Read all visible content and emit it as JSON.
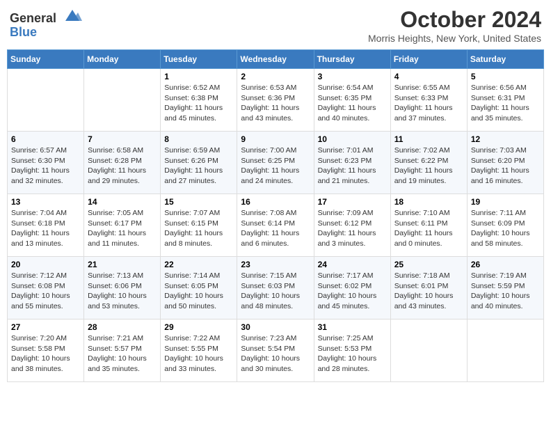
{
  "header": {
    "logo_general": "General",
    "logo_blue": "Blue",
    "month_title": "October 2024",
    "location": "Morris Heights, New York, United States"
  },
  "weekdays": [
    "Sunday",
    "Monday",
    "Tuesday",
    "Wednesday",
    "Thursday",
    "Friday",
    "Saturday"
  ],
  "weeks": [
    [
      {
        "day": "",
        "detail": ""
      },
      {
        "day": "",
        "detail": ""
      },
      {
        "day": "1",
        "detail": "Sunrise: 6:52 AM\nSunset: 6:38 PM\nDaylight: 11 hours\nand 45 minutes."
      },
      {
        "day": "2",
        "detail": "Sunrise: 6:53 AM\nSunset: 6:36 PM\nDaylight: 11 hours\nand 43 minutes."
      },
      {
        "day": "3",
        "detail": "Sunrise: 6:54 AM\nSunset: 6:35 PM\nDaylight: 11 hours\nand 40 minutes."
      },
      {
        "day": "4",
        "detail": "Sunrise: 6:55 AM\nSunset: 6:33 PM\nDaylight: 11 hours\nand 37 minutes."
      },
      {
        "day": "5",
        "detail": "Sunrise: 6:56 AM\nSunset: 6:31 PM\nDaylight: 11 hours\nand 35 minutes."
      }
    ],
    [
      {
        "day": "6",
        "detail": "Sunrise: 6:57 AM\nSunset: 6:30 PM\nDaylight: 11 hours\nand 32 minutes."
      },
      {
        "day": "7",
        "detail": "Sunrise: 6:58 AM\nSunset: 6:28 PM\nDaylight: 11 hours\nand 29 minutes."
      },
      {
        "day": "8",
        "detail": "Sunrise: 6:59 AM\nSunset: 6:26 PM\nDaylight: 11 hours\nand 27 minutes."
      },
      {
        "day": "9",
        "detail": "Sunrise: 7:00 AM\nSunset: 6:25 PM\nDaylight: 11 hours\nand 24 minutes."
      },
      {
        "day": "10",
        "detail": "Sunrise: 7:01 AM\nSunset: 6:23 PM\nDaylight: 11 hours\nand 21 minutes."
      },
      {
        "day": "11",
        "detail": "Sunrise: 7:02 AM\nSunset: 6:22 PM\nDaylight: 11 hours\nand 19 minutes."
      },
      {
        "day": "12",
        "detail": "Sunrise: 7:03 AM\nSunset: 6:20 PM\nDaylight: 11 hours\nand 16 minutes."
      }
    ],
    [
      {
        "day": "13",
        "detail": "Sunrise: 7:04 AM\nSunset: 6:18 PM\nDaylight: 11 hours\nand 13 minutes."
      },
      {
        "day": "14",
        "detail": "Sunrise: 7:05 AM\nSunset: 6:17 PM\nDaylight: 11 hours\nand 11 minutes."
      },
      {
        "day": "15",
        "detail": "Sunrise: 7:07 AM\nSunset: 6:15 PM\nDaylight: 11 hours\nand 8 minutes."
      },
      {
        "day": "16",
        "detail": "Sunrise: 7:08 AM\nSunset: 6:14 PM\nDaylight: 11 hours\nand 6 minutes."
      },
      {
        "day": "17",
        "detail": "Sunrise: 7:09 AM\nSunset: 6:12 PM\nDaylight: 11 hours\nand 3 minutes."
      },
      {
        "day": "18",
        "detail": "Sunrise: 7:10 AM\nSunset: 6:11 PM\nDaylight: 11 hours\nand 0 minutes."
      },
      {
        "day": "19",
        "detail": "Sunrise: 7:11 AM\nSunset: 6:09 PM\nDaylight: 10 hours\nand 58 minutes."
      }
    ],
    [
      {
        "day": "20",
        "detail": "Sunrise: 7:12 AM\nSunset: 6:08 PM\nDaylight: 10 hours\nand 55 minutes."
      },
      {
        "day": "21",
        "detail": "Sunrise: 7:13 AM\nSunset: 6:06 PM\nDaylight: 10 hours\nand 53 minutes."
      },
      {
        "day": "22",
        "detail": "Sunrise: 7:14 AM\nSunset: 6:05 PM\nDaylight: 10 hours\nand 50 minutes."
      },
      {
        "day": "23",
        "detail": "Sunrise: 7:15 AM\nSunset: 6:03 PM\nDaylight: 10 hours\nand 48 minutes."
      },
      {
        "day": "24",
        "detail": "Sunrise: 7:17 AM\nSunset: 6:02 PM\nDaylight: 10 hours\nand 45 minutes."
      },
      {
        "day": "25",
        "detail": "Sunrise: 7:18 AM\nSunset: 6:01 PM\nDaylight: 10 hours\nand 43 minutes."
      },
      {
        "day": "26",
        "detail": "Sunrise: 7:19 AM\nSunset: 5:59 PM\nDaylight: 10 hours\nand 40 minutes."
      }
    ],
    [
      {
        "day": "27",
        "detail": "Sunrise: 7:20 AM\nSunset: 5:58 PM\nDaylight: 10 hours\nand 38 minutes."
      },
      {
        "day": "28",
        "detail": "Sunrise: 7:21 AM\nSunset: 5:57 PM\nDaylight: 10 hours\nand 35 minutes."
      },
      {
        "day": "29",
        "detail": "Sunrise: 7:22 AM\nSunset: 5:55 PM\nDaylight: 10 hours\nand 33 minutes."
      },
      {
        "day": "30",
        "detail": "Sunrise: 7:23 AM\nSunset: 5:54 PM\nDaylight: 10 hours\nand 30 minutes."
      },
      {
        "day": "31",
        "detail": "Sunrise: 7:25 AM\nSunset: 5:53 PM\nDaylight: 10 hours\nand 28 minutes."
      },
      {
        "day": "",
        "detail": ""
      },
      {
        "day": "",
        "detail": ""
      }
    ]
  ]
}
